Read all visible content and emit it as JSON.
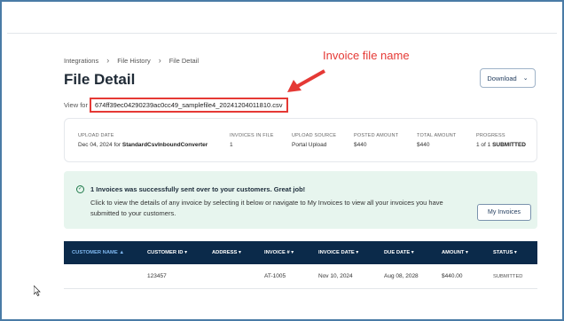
{
  "breadcrumb": [
    "Integrations",
    "File History",
    "File Detail"
  ],
  "page_title": "File Detail",
  "view_for_label": "View for",
  "file_name": "674ff39ec04290239ac0cc49_samplefile4_20241204011810.csv",
  "annotation_text": "Invoice file name",
  "download_label": "Download",
  "stats": {
    "upload_date_label": "UPLOAD DATE",
    "upload_date_value": "Dec 04, 2024 for",
    "upload_date_converter": "StandardCsvInboundConverter",
    "invoices_label": "INVOICES IN FILE",
    "invoices_value": "1",
    "source_label": "UPLOAD SOURCE",
    "source_value": "Portal Upload",
    "posted_label": "POSTED AMOUNT",
    "posted_value": "$440",
    "total_label": "TOTAL AMOUNT",
    "total_value": "$440",
    "progress_label": "PROGRESS",
    "progress_value": "1 of 1",
    "progress_status": "SUBMITTED"
  },
  "success": {
    "title": "1 Invoices was successfully sent over to your customers. Great job!",
    "text": "Click to view the details of any invoice by selecting it below or navigate to My Invoices to view all your invoices you have submitted to your customers.",
    "button": "My Invoices"
  },
  "table": {
    "columns": [
      "CUSTOMER NAME ▲",
      "CUSTOMER ID ▾",
      "ADDRESS ▾",
      "INVOICE # ▾",
      "INVOICE DATE ▾",
      "DUE DATE ▾",
      "AMOUNT ▾",
      "STATUS ▾"
    ],
    "rows": [
      [
        "",
        "123457",
        "",
        "AT-1005",
        "Nov 10, 2024",
        "Aug 08, 2028",
        "$440.00",
        "SUBMITTED"
      ]
    ]
  },
  "colors": {
    "accent_red": "#e53935",
    "table_header": "#0b2a4a",
    "success_bg": "#e7f5ee"
  }
}
